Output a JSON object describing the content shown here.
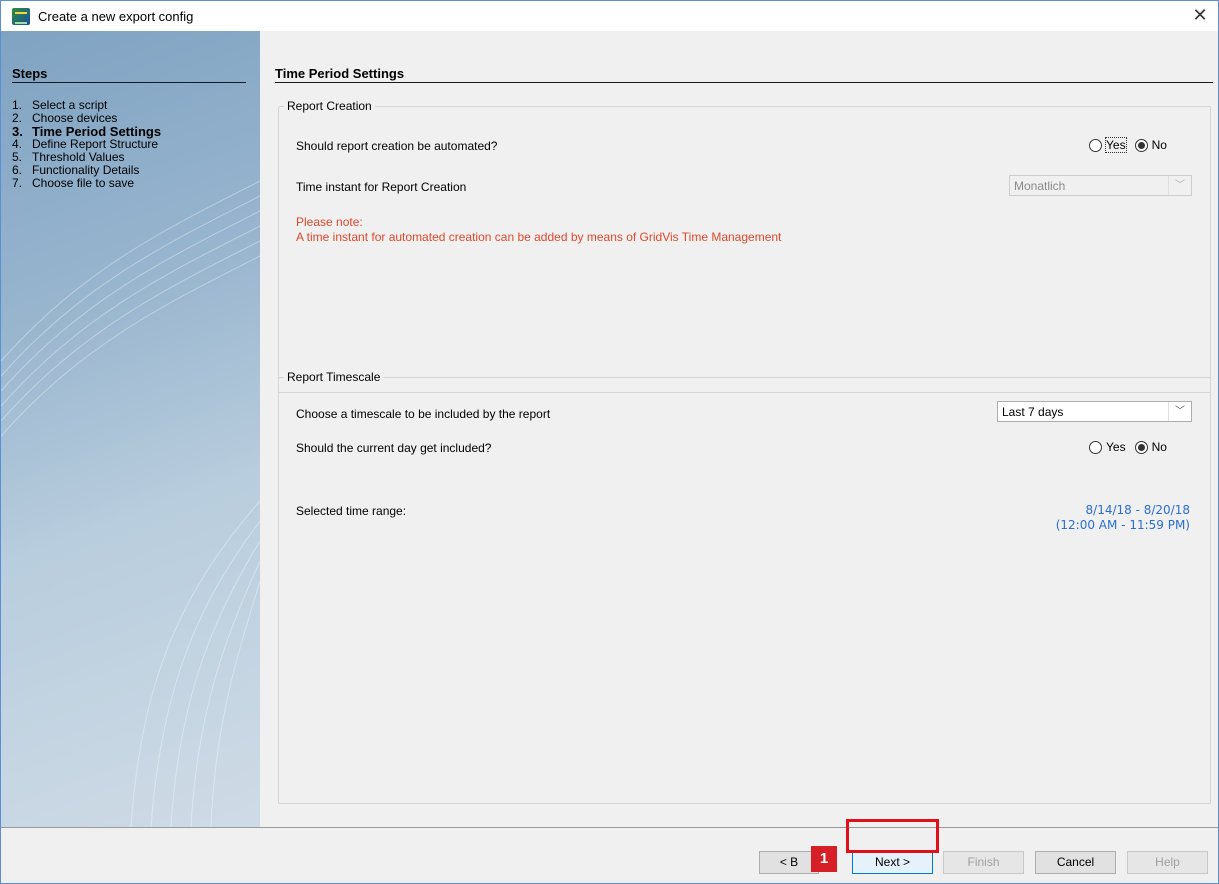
{
  "window": {
    "title": "Create a new export config",
    "close_glyph": "✕"
  },
  "sidebar": {
    "heading": "Steps",
    "steps": [
      {
        "num": "1.",
        "label": "Select a script",
        "active": false
      },
      {
        "num": "2.",
        "label": "Choose devices",
        "active": false
      },
      {
        "num": "3.",
        "label": "Time Period Settings",
        "active": true
      },
      {
        "num": "4.",
        "label": "Define Report Structure",
        "active": false
      },
      {
        "num": "5.",
        "label": "Threshold Values",
        "active": false
      },
      {
        "num": "6.",
        "label": "Functionality Details",
        "active": false
      },
      {
        "num": "7.",
        "label": "Choose file to save",
        "active": false
      }
    ]
  },
  "main": {
    "heading": "Time Period Settings",
    "report_creation": {
      "legend": "Report Creation",
      "automate_question": "Should report creation be automated?",
      "automate_yes": "Yes",
      "automate_no": "No",
      "automate_selected": "No",
      "instant_label": "Time instant for Report Creation",
      "instant_value": "Monatlich",
      "note_line1": "Please note:",
      "note_line2": "A time instant for automated creation can be added by means of GridVis Time Management"
    },
    "report_timescale": {
      "legend": "Report Timescale",
      "timescale_label": "Choose a timescale to be included by the report",
      "timescale_value": "Last 7 days",
      "current_day_question": "Should the current day get included?",
      "current_day_yes": "Yes",
      "current_day_no": "No",
      "current_day_selected": "No",
      "range_label": "Selected time range:",
      "range_dates": "8/14/18 - 8/20/18",
      "range_times": "(12:00 AM - 11:59 PM)"
    }
  },
  "footer": {
    "back_label": "< B",
    "next_label": "Next >",
    "finish_label": "Finish",
    "cancel_label": "Cancel",
    "help_label": "Help",
    "step_marker": "1"
  },
  "colors": {
    "note_red": "#e0482c",
    "range_blue": "#2a6ed3",
    "highlight_red": "#e0101a"
  }
}
